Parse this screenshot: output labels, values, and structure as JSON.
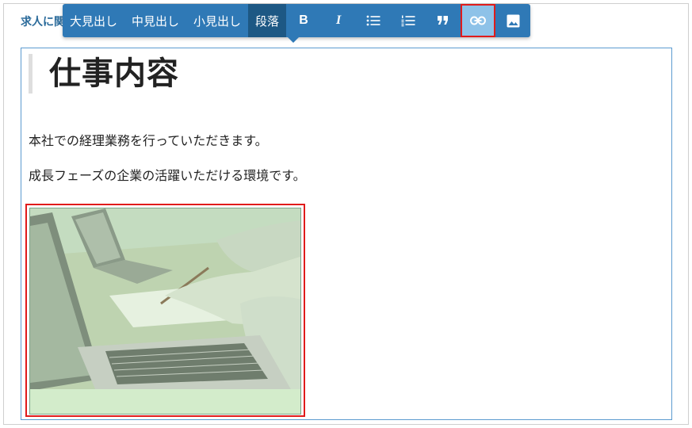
{
  "section": {
    "label": "求人に関"
  },
  "toolbar": {
    "items": [
      {
        "label": "大見出し"
      },
      {
        "label": "中見出し"
      },
      {
        "label": "小見出し"
      },
      {
        "label": "段落"
      }
    ],
    "icons": [
      "bold-icon",
      "italic-icon",
      "bullet-list-icon",
      "numbered-list-icon",
      "quote-icon",
      "link-icon",
      "image-icon"
    ],
    "bold_glyph": "B",
    "italic_glyph": "I",
    "active_item": "段落",
    "highlight_color": "#e01b1b"
  },
  "editor": {
    "heading": "仕事内容",
    "paragraphs": [
      "本社での経理業務を行っていただきます。",
      "成長フェーズの企業の活躍いただける環境です。"
    ]
  }
}
